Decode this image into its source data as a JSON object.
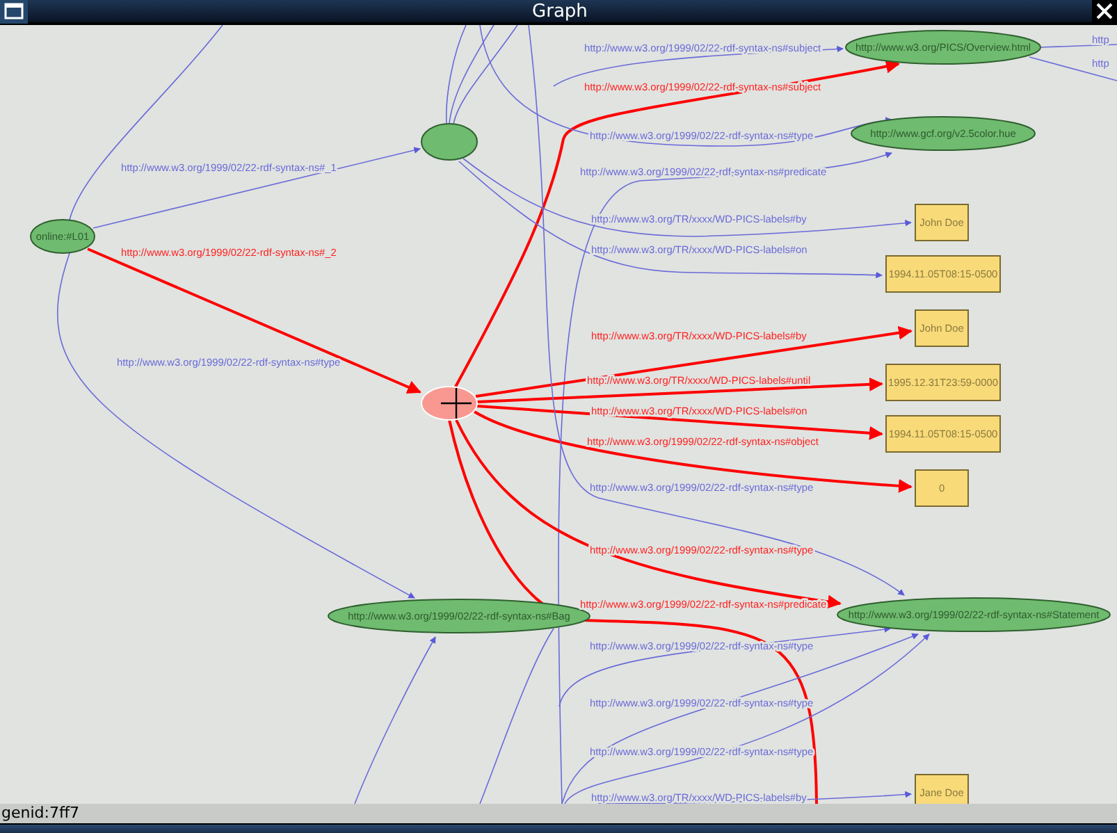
{
  "window": {
    "title": "Graph"
  },
  "graph": {
    "nodes": [
      {
        "kind": "ellipse",
        "label": "online:#L01",
        "selected": false
      },
      {
        "kind": "ellipse",
        "selected": false
      },
      {
        "kind": "ellipse",
        "label": "http://www.w3.org/PICS/Overview.html",
        "selected": false
      },
      {
        "kind": "ellipse",
        "label": "http://www.gcf.org/v2.5color.hue",
        "selected": false
      },
      {
        "kind": "box",
        "label": "John Doe",
        "selected": false
      },
      {
        "kind": "box",
        "label": "1994.11.05T08:15-0500",
        "selected": false
      },
      {
        "kind": "ellipse",
        "selected": true
      },
      {
        "kind": "box",
        "label": "John Doe",
        "selected": false
      },
      {
        "kind": "box",
        "label": "1995.12.31T23:59-0000",
        "selected": false
      },
      {
        "kind": "box",
        "label": "1994.11.05T08:15-0500",
        "selected": false
      },
      {
        "kind": "box",
        "label": "0",
        "selected": false
      },
      {
        "kind": "ellipse",
        "label": "http://www.w3.org/1999/02/22-rdf-syntax-ns#Bag",
        "selected": false
      },
      {
        "kind": "ellipse",
        "label": "http://www.w3.org/1999/02/22-rdf-syntax-ns#Statement",
        "selected": false
      },
      {
        "kind": "box",
        "label": "Jane Doe",
        "selected": false
      }
    ],
    "edges": [
      {
        "label": "http://www.w3.org/1999/02/22-rdf-syntax-ns#_1",
        "selected": false
      },
      {
        "label": "http://www.w3.org/1999/02/22-rdf-syntax-ns#_2",
        "selected": true
      },
      {
        "label": "http://www.w3.org/1999/02/22-rdf-syntax-ns#type",
        "selected": false
      },
      {
        "label": "http://www.w3.org/1999/02/22-rdf-syntax-ns#subject",
        "selected": false
      },
      {
        "label": "http://www.w3.org/1999/02/22-rdf-syntax-ns#subject",
        "selected": true
      },
      {
        "label": "http://www.w3.org/1999/02/22-rdf-syntax-ns#type",
        "selected": false
      },
      {
        "label": "http://www.w3.org/1999/02/22-rdf-syntax-ns#predicate",
        "selected": false
      },
      {
        "label": "http://www.w3.org/TR/xxxx/WD-PICS-labels#by",
        "selected": false
      },
      {
        "label": "http://www.w3.org/TR/xxxx/WD-PICS-labels#on",
        "selected": false
      },
      {
        "label": "http://www.w3.org/TR/xxxx/WD-PICS-labels#by",
        "selected": true
      },
      {
        "label": "http://www.w3.org/TR/xxxx/WD-PICS-labels#until",
        "selected": true
      },
      {
        "label": "http://www.w3.org/TR/xxxx/WD-PICS-labels#on",
        "selected": true
      },
      {
        "label": "http://www.w3.org/1999/02/22-rdf-syntax-ns#object",
        "selected": true
      },
      {
        "label": "http://www.w3.org/1999/02/22-rdf-syntax-ns#type",
        "selected": false
      },
      {
        "label": "http://www.w3.org/1999/02/22-rdf-syntax-ns#type",
        "selected": true
      },
      {
        "label": "http://www.w3.org/1999/02/22-rdf-syntax-ns#predicate",
        "selected": true
      },
      {
        "label": "http://www.w3.org/1999/02/22-rdf-syntax-ns#type",
        "selected": false
      },
      {
        "label": "http://www.w3.org/1999/02/22-rdf-syntax-ns#type",
        "selected": false
      },
      {
        "label": "http://www.w3.org/1999/02/22-rdf-syntax-ns#type",
        "selected": false
      },
      {
        "label": "http://www.w3.org/TR/xxxx/WD-PICS-labels#by",
        "selected": false
      },
      {
        "label": "http",
        "selected": false
      },
      {
        "label": "http",
        "selected": false
      },
      {
        "selected": false
      },
      {
        "selected": false
      },
      {
        "selected": false
      },
      {
        "selected": false
      },
      {
        "selected": false
      },
      {
        "selected": false
      }
    ]
  },
  "status_bar": {
    "text": "genid:7ff7"
  }
}
